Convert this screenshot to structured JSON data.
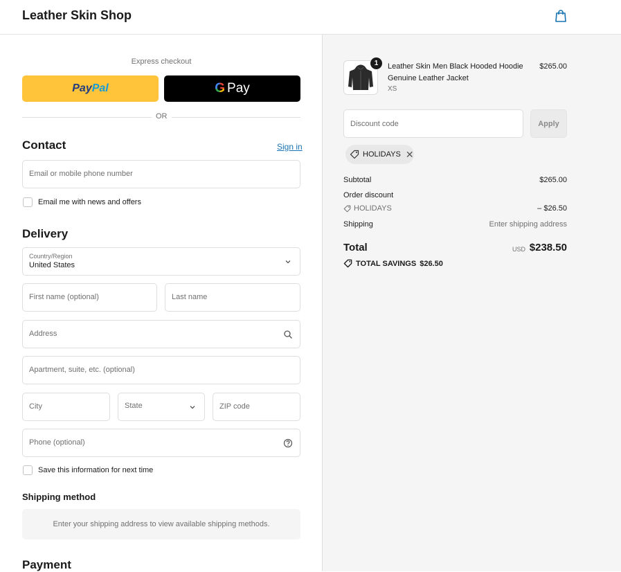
{
  "header": {
    "shop_name": "Leather Skin Shop",
    "bag_icon": "shopping-bag-icon"
  },
  "express": {
    "label": "Express checkout",
    "paypal": {
      "part1": "Pay",
      "part2": "Pal"
    },
    "gpay": {
      "g": "G",
      "label": "Pay"
    },
    "or": "OR"
  },
  "contact": {
    "title": "Contact",
    "sign_in": "Sign in",
    "email_placeholder": "Email or mobile phone number",
    "news_checkbox": "Email me with news and offers"
  },
  "delivery": {
    "title": "Delivery",
    "country_label": "Country/Region",
    "country_value": "United States",
    "first_name": "First name (optional)",
    "last_name": "Last name",
    "address": "Address",
    "apartment": "Apartment, suite, etc. (optional)",
    "city": "City",
    "state": "State",
    "zip": "ZIP code",
    "phone": "Phone (optional)",
    "save_info": "Save this information for next time"
  },
  "shipping_method": {
    "title": "Shipping method",
    "message": "Enter your shipping address to view available shipping methods."
  },
  "payment": {
    "title": "Payment"
  },
  "summary": {
    "product": {
      "name": "Leather Skin Men Black Hooded Hoodie Genuine Leather Jacket",
      "variant": "XS",
      "price": "$265.00",
      "quantity": "1"
    },
    "discount_placeholder": "Discount code",
    "apply": "Apply",
    "chip_code": "HOLIDAYS",
    "subtotal_label": "Subtotal",
    "subtotal_value": "$265.00",
    "order_discount_label": "Order discount",
    "discount_code": "HOLIDAYS",
    "discount_value": "– $26.50",
    "shipping_label": "Shipping",
    "shipping_value": "Enter shipping address",
    "total_label": "Total",
    "currency": "USD",
    "total_value": "$238.50",
    "savings_label": "TOTAL SAVINGS",
    "savings_value": "$26.50"
  }
}
